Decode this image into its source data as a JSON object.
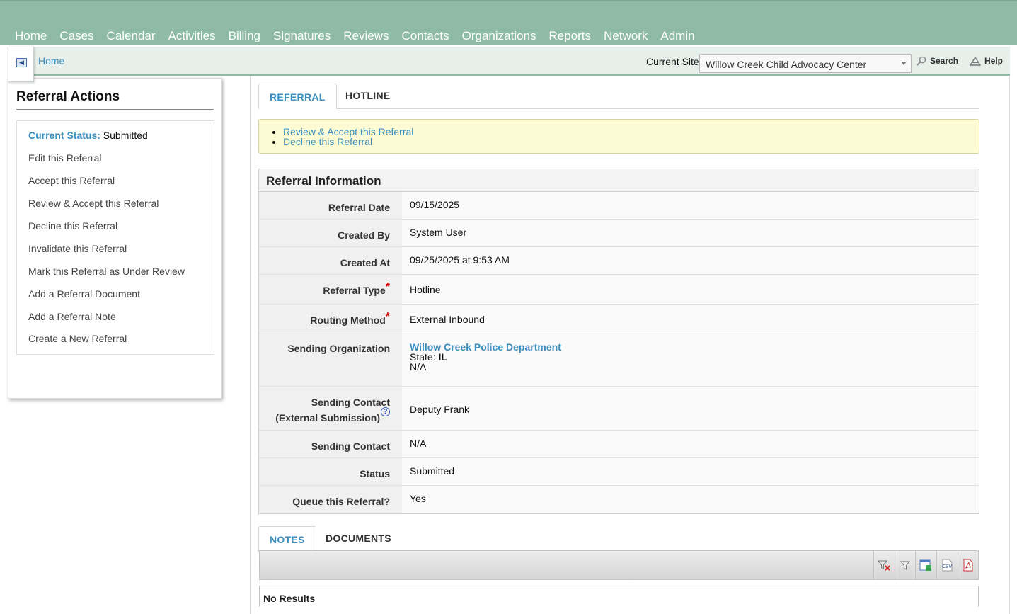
{
  "nav": {
    "items": [
      "Home",
      "Cases",
      "Calendar",
      "Activities",
      "Billing",
      "Signatures",
      "Reviews",
      "Contacts",
      "Organizations",
      "Reports",
      "Network",
      "Admin"
    ]
  },
  "subbar": {
    "breadcrumb": "Home",
    "current_site_label": "Current Site",
    "current_site_value": "Willow Creek Child Advocacy Center",
    "search_label": "Search",
    "help_label": "Help"
  },
  "sidebar": {
    "title": "Referral Actions",
    "status_key": "Current Status:",
    "status_value": "Submitted",
    "actions": [
      "Edit this Referral",
      "Accept this Referral",
      "Review & Accept this Referral",
      "Decline this Referral",
      "Invalidate this Referral",
      "Mark this Referral as Under Review",
      "Add a Referral Document",
      "Add a Referral Note",
      "Create a New Referral"
    ]
  },
  "tabs": {
    "referral": "REFERRAL",
    "hotline": "HOTLINE"
  },
  "notice": {
    "links": [
      "Review & Accept this Referral",
      "Decline this Referral"
    ]
  },
  "info": {
    "title": "Referral Information",
    "referral_date_label": "Referral Date",
    "referral_date": "09/15/2025",
    "created_by_label": "Created By",
    "created_by": "System User",
    "created_at_label": "Created At",
    "created_at": "09/25/2025 at 9:53 AM",
    "referral_type_label": "Referral Type",
    "referral_type": "Hotline",
    "routing_method_label": "Routing Method",
    "routing_method": "External Inbound",
    "sending_org_label": "Sending Organization",
    "sending_org_name": "Willow Creek Police Department",
    "sending_org_state_key": "State:",
    "sending_org_state": "IL",
    "sending_org_extra": "N/A",
    "sending_contact_ext_label_1": "Sending Contact",
    "sending_contact_ext_label_2": "(External Submission)",
    "sending_contact_ext": "Deputy Frank",
    "sending_contact_label": "Sending Contact",
    "sending_contact": "N/A",
    "status_label": "Status",
    "status": "Submitted",
    "queue_label": "Queue this Referral?",
    "queue": "Yes",
    "required_mark": "*",
    "help_mark": "?"
  },
  "bottom_tabs": {
    "notes": "NOTES",
    "documents": "DOCUMENTS"
  },
  "grid": {
    "csv_label": "CSV",
    "empty_text": "No Results"
  },
  "colors": {
    "nav_bg": "#8fbba6",
    "link": "#3a8fc1",
    "notice_bg": "#fdfbd4",
    "required": "#d10000"
  }
}
